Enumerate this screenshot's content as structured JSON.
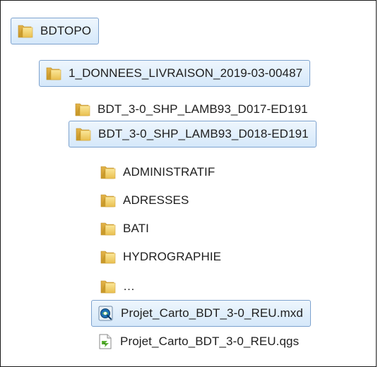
{
  "tree": {
    "root": {
      "label": "BDTOPO",
      "icon": "folder-icon",
      "selected": true
    },
    "livraison": {
      "label": "1_DONNEES_LIVRAISON_2019-03-00487",
      "icon": "folder-icon",
      "selected": true
    },
    "d017": {
      "label": "BDT_3-0_SHP_LAMB93_D017-ED191",
      "icon": "folder-icon",
      "selected": false
    },
    "d018": {
      "label": "BDT_3-0_SHP_LAMB93_D018-ED191",
      "icon": "folder-icon",
      "selected": true
    },
    "administratif": {
      "label": "ADMINISTRATIF",
      "icon": "folder-icon",
      "selected": false
    },
    "adresses": {
      "label": "ADRESSES",
      "icon": "folder-icon",
      "selected": false
    },
    "bati": {
      "label": "BATI",
      "icon": "folder-icon",
      "selected": false
    },
    "hydrographie": {
      "label": "HYDROGRAPHIE",
      "icon": "folder-icon",
      "selected": false
    },
    "more": {
      "label": "…",
      "icon": "folder-icon",
      "selected": false
    },
    "mxd": {
      "label": "Projet_Carto_BDT_3-0_REU.mxd",
      "icon": "arcmap-document-icon",
      "selected": true
    },
    "qgs": {
      "label": "Projet_Carto_BDT_3-0_REU.qgs",
      "icon": "qgis-project-icon",
      "selected": false
    }
  },
  "colors": {
    "folder_front": "#f3d26b",
    "folder_back": "#d9a93a",
    "selection_border": "#7da2ce",
    "selection_fill": "#dcebfb"
  }
}
